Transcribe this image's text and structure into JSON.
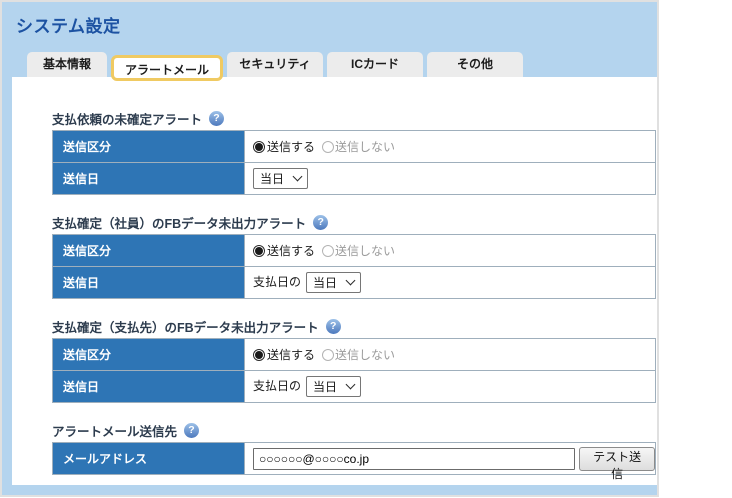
{
  "title": "システム設定",
  "help_glyph": "?",
  "tabs": [
    {
      "label": "基本情報",
      "active": false
    },
    {
      "label": "アラートメール",
      "active": true
    },
    {
      "label": "セキュリティ",
      "active": false
    },
    {
      "label": "ICカード",
      "active": false
    },
    {
      "label": "その他",
      "active": false
    }
  ],
  "sections": [
    {
      "heading": "支払依頼の未確定アラート",
      "send_type_label": "送信区分",
      "option_on": "送信する",
      "option_off": "送信しない",
      "option_selected": "送信する",
      "send_day_label": "送信日",
      "send_day_prefix": "",
      "send_day_value": "当日"
    },
    {
      "heading": "支払確定（社員）のFBデータ未出力アラート",
      "send_type_label": "送信区分",
      "option_on": "送信する",
      "option_off": "送信しない",
      "option_selected": "送信する",
      "send_day_label": "送信日",
      "send_day_prefix": "支払日の",
      "send_day_value": "当日"
    },
    {
      "heading": "支払確定（支払先）のFBデータ未出力アラート",
      "send_type_label": "送信区分",
      "option_on": "送信する",
      "option_off": "送信しない",
      "option_selected": "送信する",
      "send_day_label": "送信日",
      "send_day_prefix": "支払日の",
      "send_day_value": "当日"
    }
  ],
  "email": {
    "heading": "アラートメール送信先",
    "field_label": "メールアドレス",
    "value": "○○○○○○@○○○○co.jp",
    "test_button": "テスト送信"
  },
  "colors": {
    "header_bg": "#b4d4ee",
    "accent_blue": "#2e75b5",
    "active_tab_border": "#f0ca62",
    "title_color": "#1c52a2"
  }
}
